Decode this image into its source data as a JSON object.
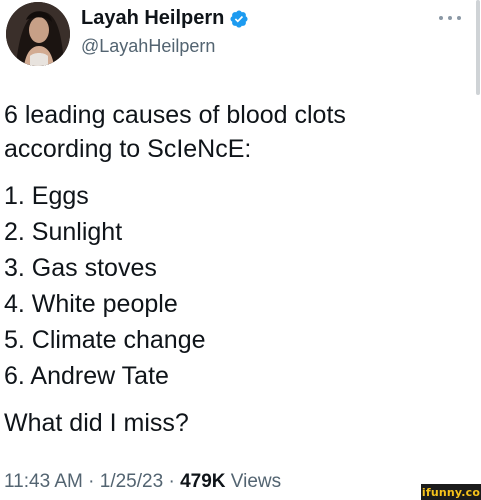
{
  "author": {
    "display_name": "Layah Heilpern",
    "handle": "@LayahHeilpern",
    "verified": true
  },
  "tweet": {
    "intro_line1": "6 leading causes of blood clots",
    "intro_line2": "according to ScIeNcE:",
    "items": [
      "1. Eggs",
      "2. Sunlight",
      "3. Gas stoves",
      "4. White people",
      "5. Climate change",
      "6. Andrew Tate"
    ],
    "closing": "What did I miss?"
  },
  "meta": {
    "time": "11:43 AM",
    "separator": "·",
    "date": "1/25/23",
    "views_count": "479K",
    "views_label": "Views"
  },
  "watermark": {
    "text": "ifunny.co"
  },
  "colors": {
    "text": "#0f1419",
    "secondary": "#536471",
    "verified": "#1d9bf0"
  }
}
